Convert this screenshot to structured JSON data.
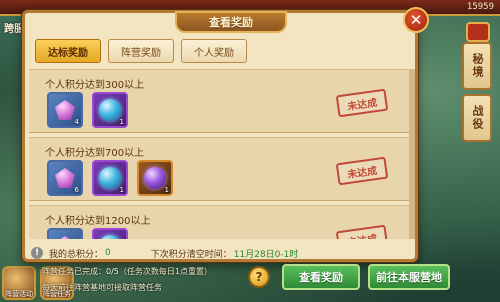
{
  "background": {
    "top_left_title": "跨服",
    "top_right_number": "15959",
    "side_tabs": [
      "秘境",
      "战役"
    ],
    "bottom_left_labels": [
      "阵营活动",
      "阵营任务"
    ]
  },
  "dialog": {
    "title": "查看奖励",
    "close_symbol": "✕",
    "tabs": [
      {
        "label": "达标奖励",
        "active": true
      },
      {
        "label": "阵营奖励",
        "active": false
      },
      {
        "label": "个人奖励",
        "active": false
      }
    ],
    "rows": [
      {
        "title": "个人积分达到300以上",
        "status": "未达成",
        "items": [
          {
            "icon": "pink-gem-icon",
            "frame": "blue",
            "count": "4"
          },
          {
            "icon": "blue-orb-icon",
            "frame": "purple",
            "count": "1"
          }
        ]
      },
      {
        "title": "个人积分达到700以上",
        "status": "未达成",
        "items": [
          {
            "icon": "pink-gem-icon",
            "frame": "blue",
            "count": "6"
          },
          {
            "icon": "blue-orb-icon",
            "frame": "purple",
            "count": "1"
          },
          {
            "icon": "violet-orb-icon",
            "frame": "orange",
            "count": "1"
          }
        ]
      },
      {
        "title": "个人积分达到1200以上",
        "status": "未达成",
        "items": [
          {
            "icon": "pink-gem-icon",
            "frame": "blue",
            "count": ""
          },
          {
            "icon": "blue-orb-icon",
            "frame": "purple",
            "count": ""
          }
        ]
      }
    ],
    "info": {
      "score_label": "我的总积分：",
      "score_value": "0",
      "clear_label": "下次积分清空时间：",
      "clear_time": "11月28日0-1时"
    }
  },
  "bottom": {
    "task_label": "阵营任务已完成：",
    "task_progress": "0/5",
    "task_note": "（任务次数每日1点重置）",
    "task_line2": "每天前往阵营基地可接取阵营任务",
    "help_symbol": "?",
    "view_rewards_button": "查看奖励",
    "go_camp_button": "前往本服营地"
  },
  "colors": {
    "accent_gold": "#e5a624",
    "stamp_red": "#c04a3a",
    "button_green": "#2f8a36"
  }
}
